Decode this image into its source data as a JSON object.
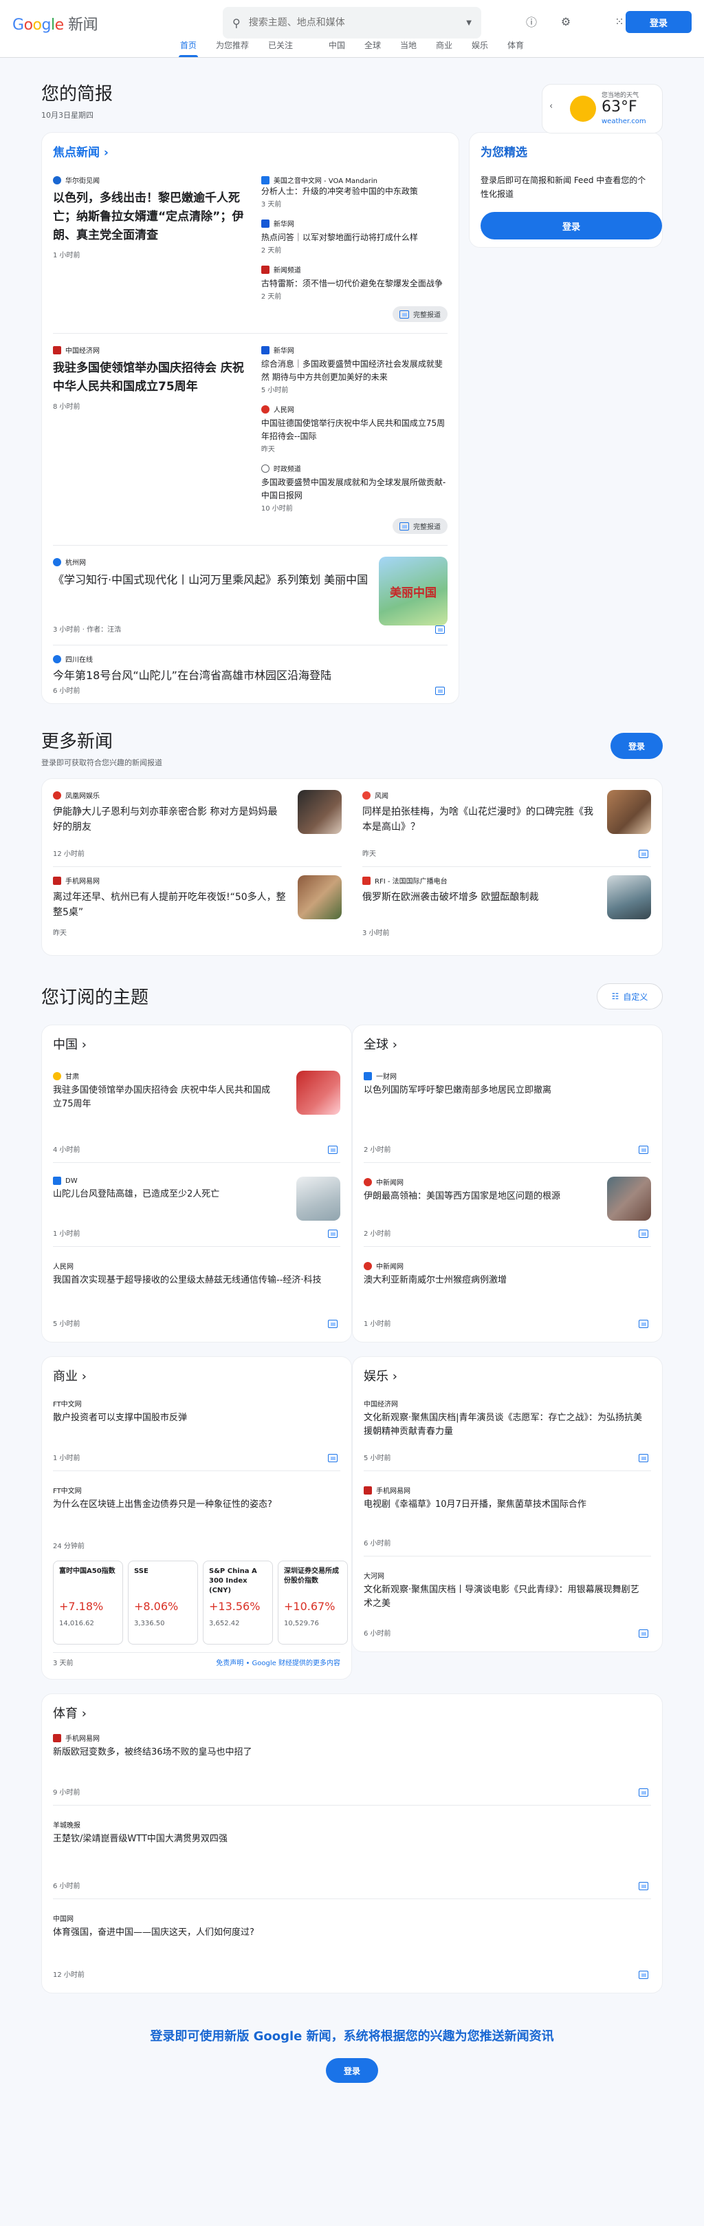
{
  "header": {
    "logo_google": "Google",
    "logo_news": "新闻",
    "search_placeholder": "搜索主题、地点和媒体",
    "login": "登录"
  },
  "tabs": [
    "首页",
    "为您推荐",
    "已关注",
    "中国",
    "全球",
    "当地",
    "商业",
    "娱乐",
    "体育"
  ],
  "brief": {
    "title": "您的简报",
    "date": "10月3日星期四"
  },
  "weather": {
    "label": "您当地的天气",
    "temp": "63°F",
    "source": "weather.com"
  },
  "focus": {
    "title": "焦点新闻",
    "story1": {
      "pub": "华尔街见闻",
      "title": "以色列，多线出击！黎巴嫩逾千人死亡；纳斯鲁拉女婿遭“定点清除”；伊朗、真主党全面清查",
      "time": "1 小时前",
      "side": [
        {
          "pub": "美国之音中文网 - VOA Mandarin",
          "title": "分析人士：升级的冲突考验中国的中东政策",
          "time": "3 天前"
        },
        {
          "pub": "新华网",
          "title": "热点问答｜以军对黎地面行动将打成什么样",
          "time": "2 天前"
        },
        {
          "pub": "新闻频道",
          "title": "古特雷斯：须不惜一切代价避免在黎爆发全面战争",
          "time": "2 天前"
        }
      ],
      "full": "完整报道"
    },
    "story2": {
      "pub": "中国经济网",
      "title": "我驻多国使领馆举办国庆招待会 庆祝中华人民共和国成立75周年",
      "time": "8 小时前",
      "side": [
        {
          "pub": "新华网",
          "title": "综合消息｜多国政要盛赞中国经济社会发展成就斐然 期待与中方共创更加美好的未来",
          "time": "5 小时前"
        },
        {
          "pub": "人民网",
          "title": "中国驻德国使馆举行庆祝中华人民共和国成立75周年招待会--国际",
          "time": "昨天"
        },
        {
          "pub": "时政频道",
          "title": "多国政要盛赞中国发展成就和为全球发展所做贡献- 中国日报网",
          "time": "10 小时前"
        }
      ],
      "full": "完整报道"
    },
    "story3": {
      "pub": "杭州网",
      "title": "《学习知行·中国式现代化丨山河万里乘风起》系列策划 美丽中国",
      "time": "3 小时前 · 作者：汪浩",
      "thumb_text": "美丽中国"
    },
    "story4": {
      "pub": "四川在线",
      "title": "今年第18号台风“山陀儿”在台湾省高雄市林园区沿海登陆",
      "time": "6 小时前"
    }
  },
  "picks": {
    "title": "为您精选",
    "text": "登录后即可在简报和新闻 Feed 中查看您的个性化报道",
    "login": "登录"
  },
  "more": {
    "title": "更多新闻",
    "subtitle": "登录即可获取符合您兴趣的新闻报道",
    "login": "登录",
    "items": [
      {
        "pub": "凤凰网娱乐",
        "title": "伊能静大儿子恩利与刘亦菲亲密合影 称对方是妈妈最好的朋友",
        "time": "12 小时前"
      },
      {
        "pub": "风闻",
        "title": "同样是拍张桂梅，为啥《山花烂漫时》的口碑完胜《我本是高山》？",
        "time": "昨天"
      },
      {
        "pub": "手机网易网",
        "title": "离过年还早、杭州已有人提前开吃年夜饭!“50多人，整整5桌”",
        "time": "昨天"
      },
      {
        "pub": "RFI - 法国国际广播电台",
        "title": "俄罗斯在欧洲袭击破坏增多 欧盟酝酿制裁",
        "time": "3 小时前"
      }
    ]
  },
  "topics": {
    "title": "您订阅的主题",
    "customize": "自定义",
    "china": {
      "title": "中国",
      "items": [
        {
          "pub": "甘肃",
          "title": "我驻多国使领馆举办国庆招待会 庆祝中华人民共和国成立75周年",
          "time": "4 小时前"
        },
        {
          "pub": "DW",
          "title": "山陀儿台风登陆高雄，已造成至少2人死亡",
          "time": "1 小时前"
        },
        {
          "pub": "人民网",
          "title": "我国首次实现基于超导接收的公里级太赫兹无线通信传输--经济·科技",
          "time": "5 小时前"
        }
      ]
    },
    "world": {
      "title": "全球",
      "items": [
        {
          "pub": "一财网",
          "title": "以色列国防军呼吁黎巴嫩南部多地居民立即撤离",
          "time": "2 小时前"
        },
        {
          "pub": "中新闻网",
          "title": "伊朗最高领袖：美国等西方国家是地区问题的根源",
          "time": "2 小时前"
        },
        {
          "pub": "中新闻网",
          "title": "澳大利亚新南威尔士州猴痘病例激增",
          "time": "1 小时前"
        }
      ]
    },
    "business": {
      "title": "商业",
      "items": [
        {
          "pub": "FT中文网",
          "title": "散户投资者可以支撑中国股市反弹",
          "time": "1 小时前"
        },
        {
          "pub": "FT中文网",
          "title": "为什么在区块链上出售金边债券只是一种象征性的姿态?",
          "time": "24 分钟前"
        }
      ],
      "stocks": [
        {
          "name": "富时中国A50指数",
          "pct": "+7.18%",
          "val": "14,016.62"
        },
        {
          "name": "SSE",
          "pct": "+8.06%",
          "val": "3,336.50"
        },
        {
          "name": "S&P China A 300 Index (CNY)",
          "pct": "+13.56%",
          "val": "3,652.42"
        },
        {
          "name": "深圳证券交易所成份股价指数",
          "pct": "+10.67%",
          "val": "10,529.76"
        }
      ],
      "time": "3 天前",
      "disclaimer": "免责声明",
      "gf": "Google 财经提供的更多内容"
    },
    "ent": {
      "title": "娱乐",
      "items": [
        {
          "pub": "中国经济网",
          "title": "文化新观察·聚焦国庆档|青年演员谈《志愿军：存亡之战》：为弘扬抗美援朝精神贡献青春力量",
          "time": "5 小时前"
        },
        {
          "pub": "手机网易网",
          "title": "电视剧《幸福草》10月7日开播，聚焦菌草技术国际合作",
          "time": "6 小时前"
        },
        {
          "pub": "大河网",
          "title": "文化新观察·聚焦国庆档丨导演谈电影《只此青绿》：用银幕展现舞剧艺术之美",
          "time": "6 小时前"
        }
      ]
    },
    "sports": {
      "title": "体育",
      "items": [
        {
          "pub": "手机网易网",
          "title": "新版欧冠变数多，被终结36场不败的皇马也中招了",
          "time": "9 小时前"
        },
        {
          "pub": "羊城晚报",
          "title": "王楚钦/梁靖崑晋级WTT中国大满贯男双四强",
          "time": "6 小时前"
        },
        {
          "pub": "中国网",
          "title": "体育强国，奋进中国——国庆这天，人们如何度过?",
          "time": "12 小时前"
        }
      ]
    }
  },
  "footer": {
    "text": "登录即可使用新版 Google 新闻，系统将根据您的兴趣为您推送新闻资讯",
    "login": "登录"
  }
}
